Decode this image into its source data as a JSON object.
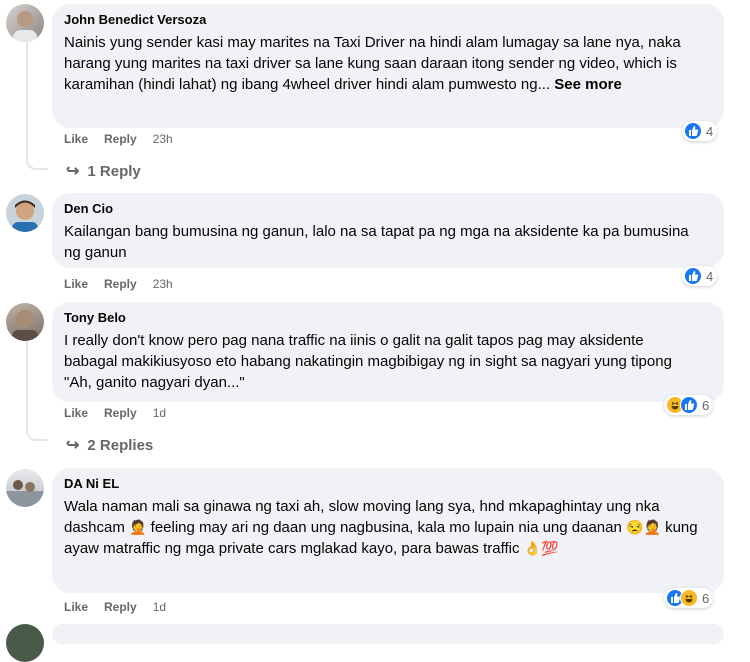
{
  "comments": [
    {
      "author": "John Benedict Versoza",
      "text": "Nainis yung sender kasi may marites na Taxi Driver na hindi alam lumagay sa lane nya, naka harang yung marites na taxi driver sa lane kung saan daraan itong sender ng video, which is karamihan (hindi lahat) ng ibang 4wheel driver hindi alam pumwesto ng...",
      "see_more": "See more",
      "like_label": "Like",
      "reply_label": "Reply",
      "time": "23h",
      "reaction_count": "4",
      "reactions": [
        "like-icon"
      ],
      "replies_label": "1 Reply"
    },
    {
      "author": "Den Cio",
      "text": "Kailangan bang bumusina ng ganun, lalo na sa tapat pa ng mga na aksidente ka pa bumusina ng ganun",
      "like_label": "Like",
      "reply_label": "Reply",
      "time": "23h",
      "reaction_count": "4",
      "reactions": [
        "like-icon"
      ]
    },
    {
      "author": "Tony Belo",
      "text": "I really don't know pero pag nana traffic na iinis o galit na galit tapos pag may aksidente babagal makikiusyoso eto habang nakatingin magbibigay ng in sight sa nagyari yung tipong \"Ah, ganito nagyari dyan...\"",
      "like_label": "Like",
      "reply_label": "Reply",
      "time": "1d",
      "reaction_count": "6",
      "reactions": [
        "haha-icon",
        "like-icon"
      ],
      "replies_label": "2 Replies"
    },
    {
      "author": "DA Ni EL",
      "text_part1": "Wala naman mali sa ginawa ng taxi ah, slow moving lang sya, hnd mkapaghintay ung nka dashcam",
      "emoji1": "🤦",
      "text_part2": "feeling may ari ng daan ung nagbusina, kala mo lupain nia ung daanan",
      "emoji2": "😒🤦",
      "text_part3": "kung ayaw matraffic ng mga private cars mglakad kayo, para bawas traffic",
      "emoji3": "👌💯",
      "like_label": "Like",
      "reply_label": "Reply",
      "time": "1d",
      "reaction_count": "6",
      "reactions": [
        "like-icon",
        "haha-icon"
      ]
    }
  ],
  "colors": {
    "bubble": "#f0f2f5",
    "meta": "#65676b",
    "like_blue": "#1877f2",
    "haha_yellow": "#f7b928"
  }
}
